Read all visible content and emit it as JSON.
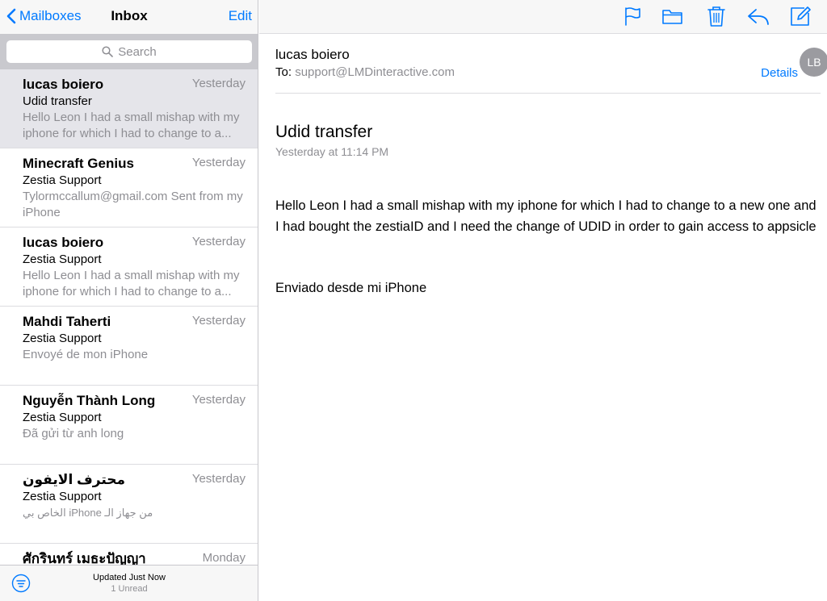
{
  "sidebar": {
    "back_label": "Mailboxes",
    "title": "Inbox",
    "edit_label": "Edit",
    "search_placeholder": "Search",
    "messages": [
      {
        "sender": "lucas boiero",
        "date": "Yesterday",
        "subject": "Udid transfer",
        "preview": "Hello Leon I had a small mishap with my iphone for which I had to change to a..."
      },
      {
        "sender": "Minecraft Genius",
        "date": "Yesterday",
        "subject": "Zestia Support",
        "preview": "Tylormccallum@gmail.com Sent from my iPhone"
      },
      {
        "sender": "lucas boiero",
        "date": "Yesterday",
        "subject": "Zestia Support",
        "preview": "Hello Leon I had a small mishap with my iphone for which I had to change to a..."
      },
      {
        "sender": "Mahdi Taherti",
        "date": "Yesterday",
        "subject": "Zestia Support",
        "preview": "Envoyé de mon iPhone"
      },
      {
        "sender": "Nguyễn Thành Long",
        "date": "Yesterday",
        "subject": "Zestia Support",
        "preview": "Đã gửi từ anh long"
      },
      {
        "sender": "محترف الايفون",
        "date": "Yesterday",
        "subject": "Zestia Support",
        "preview": "من جهاز الـ iPhone الخاص بي"
      },
      {
        "sender": "ศักรินทร์ เมธะปัญญา",
        "date": "Monday",
        "subject": "",
        "preview": ""
      }
    ],
    "footer": {
      "updated": "Updated Just Now",
      "unread": "1 Unread"
    }
  },
  "message": {
    "from": "lucas boiero",
    "to_label": "To:",
    "to_address": "support@LMDinteractive.com",
    "details_label": "Details",
    "avatar_initials": "LB",
    "subject": "Udid transfer",
    "date": "Yesterday at 11:14 PM",
    "body": "Hello Leon I had a small mishap with my iphone for which I had to change to a new one and I had bought the zestiaID and I need the change of UDID in order to gain access to appsicle",
    "signature": "Enviado desde mi iPhone"
  },
  "toolbar": {
    "icons": [
      "flag-icon",
      "folder-icon",
      "trash-icon",
      "reply-icon",
      "compose-icon"
    ]
  },
  "colors": {
    "accent": "#007aff",
    "secondary_text": "#8e8e93",
    "selected_row": "#e5e5ea"
  }
}
